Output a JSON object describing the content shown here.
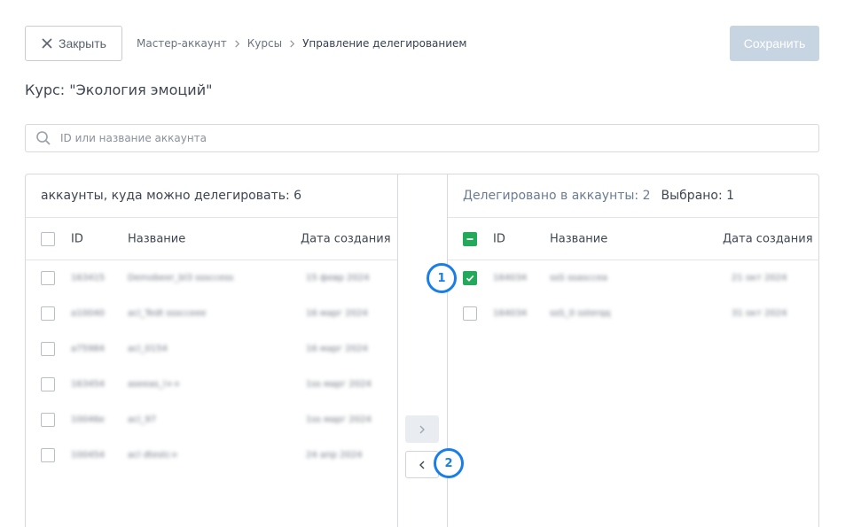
{
  "header": {
    "close_label": "Закрыть",
    "save_label": "Сохранить",
    "breadcrumb": [
      "Мастер-аккаунт",
      "Курсы",
      "Управление делегированием"
    ]
  },
  "course_title": "Курс: \"Экология эмоций\"",
  "search": {
    "placeholder": "ID или название аккаунта",
    "value": ""
  },
  "left_panel": {
    "title": "аккаунты, куда можно делегировать: 6",
    "columns": {
      "id": "ID",
      "name": "Название",
      "date": "Дата создания"
    },
    "rows": [
      {
        "id": "163415",
        "name": "Demobeer_bl3 sssccess",
        "date": "15 февр 2024",
        "checked": false
      },
      {
        "id": "a10040",
        "name": "acl_Tedt ssscceee",
        "date": "16 марг 2024",
        "checked": false
      },
      {
        "id": "a75984",
        "name": "acl_0154",
        "date": "16 марг 2024",
        "checked": false
      },
      {
        "id": "163454",
        "name": "aseeas_l++",
        "date": "1ss марг 2024",
        "checked": false
      },
      {
        "id": "10046e",
        "name": "acl_97",
        "date": "1ss марг 2024",
        "checked": false
      },
      {
        "id": "100454",
        "name": "aсl dtestc+",
        "date": "24 апр 2024",
        "checked": false
      }
    ]
  },
  "right_panel": {
    "title": "Делегировано в аккаунты: 2",
    "selected_text": "Выбрано: 1",
    "columns": {
      "id": "ID",
      "name": "Название",
      "date": "Дата создания"
    },
    "rows": [
      {
        "id": "164034",
        "name": "ssS ssasccea",
        "date": "21 окт 2024",
        "checked": true
      },
      {
        "id": "164034",
        "name": "ssS_0 ssterqq",
        "date": "31 окт 2024",
        "checked": false
      }
    ]
  },
  "markers": [
    "1",
    "2"
  ],
  "colors": {
    "accent_green": "#23a95a",
    "marker_blue": "#1a7ee8",
    "save_disabled": "#c7d4e2"
  }
}
